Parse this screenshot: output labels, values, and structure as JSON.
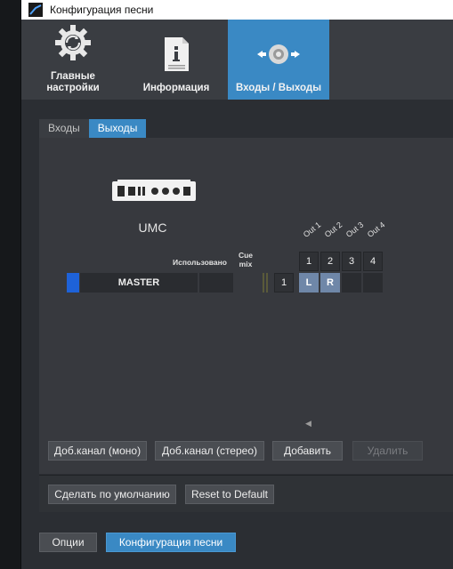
{
  "titlebar": {
    "title": "Конфигурация песни"
  },
  "toptabs": [
    {
      "label_line1": "Главные",
      "label_line2": "настройки",
      "icon": "gear-sync-icon"
    },
    {
      "label_line1": "Информация",
      "label_line2": "",
      "icon": "info-document-icon"
    },
    {
      "label_line1": "Входы / Выходы",
      "label_line2": "",
      "icon": "speaker-io-icon"
    }
  ],
  "subtabs": {
    "inputs": "Входы",
    "outputs": "Выходы"
  },
  "device": {
    "name": "UMC",
    "icon": "audio-interface-icon"
  },
  "grid": {
    "used_label": "Использовано",
    "cue_label_1": "Cue",
    "cue_label_2": "mix",
    "out_labels": [
      "Out 1",
      "Out 2",
      "Out 3",
      "Out 4"
    ],
    "out_numbers": [
      "1",
      "2",
      "3",
      "4"
    ],
    "channel_name": "MASTER",
    "channel_number": "1",
    "left_label": "L",
    "right_label": "R"
  },
  "buttons": {
    "add_mono": "Доб.канал (моно)",
    "add_stereo": "Доб.канал (стерео)",
    "add": "Добавить",
    "remove": "Удалить",
    "make_default": "Сделать по умолчанию",
    "reset_default": "Reset to Default",
    "options": "Опции",
    "song_config": "Конфигурация песни"
  },
  "colors": {
    "accent": "#3a89c4",
    "channel_marker": "#1e62d8",
    "selected_cell": "#6f87a8"
  }
}
